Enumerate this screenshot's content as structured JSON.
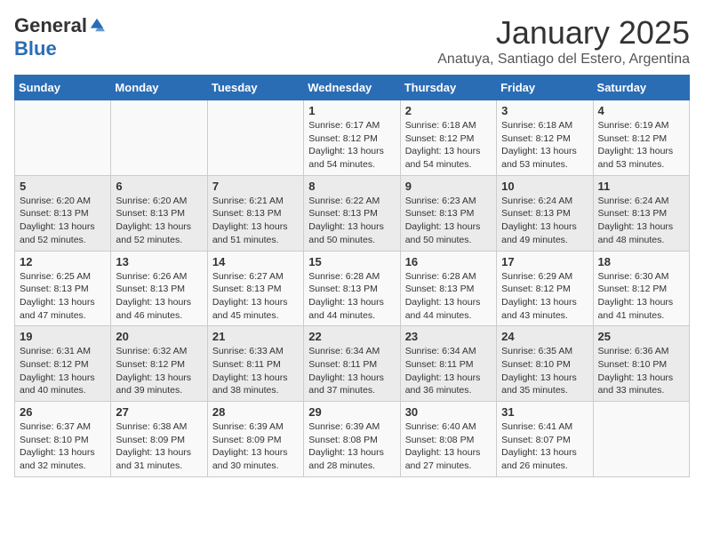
{
  "logo": {
    "general": "General",
    "blue": "Blue"
  },
  "title": "January 2025",
  "subtitle": "Anatuya, Santiago del Estero, Argentina",
  "days_of_week": [
    "Sunday",
    "Monday",
    "Tuesday",
    "Wednesday",
    "Thursday",
    "Friday",
    "Saturday"
  ],
  "weeks": [
    [
      {
        "num": "",
        "sunrise": "",
        "sunset": "",
        "daylight": ""
      },
      {
        "num": "",
        "sunrise": "",
        "sunset": "",
        "daylight": ""
      },
      {
        "num": "",
        "sunrise": "",
        "sunset": "",
        "daylight": ""
      },
      {
        "num": "1",
        "sunrise": "Sunrise: 6:17 AM",
        "sunset": "Sunset: 8:12 PM",
        "daylight": "Daylight: 13 hours and 54 minutes."
      },
      {
        "num": "2",
        "sunrise": "Sunrise: 6:18 AM",
        "sunset": "Sunset: 8:12 PM",
        "daylight": "Daylight: 13 hours and 54 minutes."
      },
      {
        "num": "3",
        "sunrise": "Sunrise: 6:18 AM",
        "sunset": "Sunset: 8:12 PM",
        "daylight": "Daylight: 13 hours and 53 minutes."
      },
      {
        "num": "4",
        "sunrise": "Sunrise: 6:19 AM",
        "sunset": "Sunset: 8:12 PM",
        "daylight": "Daylight: 13 hours and 53 minutes."
      }
    ],
    [
      {
        "num": "5",
        "sunrise": "Sunrise: 6:20 AM",
        "sunset": "Sunset: 8:13 PM",
        "daylight": "Daylight: 13 hours and 52 minutes."
      },
      {
        "num": "6",
        "sunrise": "Sunrise: 6:20 AM",
        "sunset": "Sunset: 8:13 PM",
        "daylight": "Daylight: 13 hours and 52 minutes."
      },
      {
        "num": "7",
        "sunrise": "Sunrise: 6:21 AM",
        "sunset": "Sunset: 8:13 PM",
        "daylight": "Daylight: 13 hours and 51 minutes."
      },
      {
        "num": "8",
        "sunrise": "Sunrise: 6:22 AM",
        "sunset": "Sunset: 8:13 PM",
        "daylight": "Daylight: 13 hours and 50 minutes."
      },
      {
        "num": "9",
        "sunrise": "Sunrise: 6:23 AM",
        "sunset": "Sunset: 8:13 PM",
        "daylight": "Daylight: 13 hours and 50 minutes."
      },
      {
        "num": "10",
        "sunrise": "Sunrise: 6:24 AM",
        "sunset": "Sunset: 8:13 PM",
        "daylight": "Daylight: 13 hours and 49 minutes."
      },
      {
        "num": "11",
        "sunrise": "Sunrise: 6:24 AM",
        "sunset": "Sunset: 8:13 PM",
        "daylight": "Daylight: 13 hours and 48 minutes."
      }
    ],
    [
      {
        "num": "12",
        "sunrise": "Sunrise: 6:25 AM",
        "sunset": "Sunset: 8:13 PM",
        "daylight": "Daylight: 13 hours and 47 minutes."
      },
      {
        "num": "13",
        "sunrise": "Sunrise: 6:26 AM",
        "sunset": "Sunset: 8:13 PM",
        "daylight": "Daylight: 13 hours and 46 minutes."
      },
      {
        "num": "14",
        "sunrise": "Sunrise: 6:27 AM",
        "sunset": "Sunset: 8:13 PM",
        "daylight": "Daylight: 13 hours and 45 minutes."
      },
      {
        "num": "15",
        "sunrise": "Sunrise: 6:28 AM",
        "sunset": "Sunset: 8:13 PM",
        "daylight": "Daylight: 13 hours and 44 minutes."
      },
      {
        "num": "16",
        "sunrise": "Sunrise: 6:28 AM",
        "sunset": "Sunset: 8:13 PM",
        "daylight": "Daylight: 13 hours and 44 minutes."
      },
      {
        "num": "17",
        "sunrise": "Sunrise: 6:29 AM",
        "sunset": "Sunset: 8:12 PM",
        "daylight": "Daylight: 13 hours and 43 minutes."
      },
      {
        "num": "18",
        "sunrise": "Sunrise: 6:30 AM",
        "sunset": "Sunset: 8:12 PM",
        "daylight": "Daylight: 13 hours and 41 minutes."
      }
    ],
    [
      {
        "num": "19",
        "sunrise": "Sunrise: 6:31 AM",
        "sunset": "Sunset: 8:12 PM",
        "daylight": "Daylight: 13 hours and 40 minutes."
      },
      {
        "num": "20",
        "sunrise": "Sunrise: 6:32 AM",
        "sunset": "Sunset: 8:12 PM",
        "daylight": "Daylight: 13 hours and 39 minutes."
      },
      {
        "num": "21",
        "sunrise": "Sunrise: 6:33 AM",
        "sunset": "Sunset: 8:11 PM",
        "daylight": "Daylight: 13 hours and 38 minutes."
      },
      {
        "num": "22",
        "sunrise": "Sunrise: 6:34 AM",
        "sunset": "Sunset: 8:11 PM",
        "daylight": "Daylight: 13 hours and 37 minutes."
      },
      {
        "num": "23",
        "sunrise": "Sunrise: 6:34 AM",
        "sunset": "Sunset: 8:11 PM",
        "daylight": "Daylight: 13 hours and 36 minutes."
      },
      {
        "num": "24",
        "sunrise": "Sunrise: 6:35 AM",
        "sunset": "Sunset: 8:10 PM",
        "daylight": "Daylight: 13 hours and 35 minutes."
      },
      {
        "num": "25",
        "sunrise": "Sunrise: 6:36 AM",
        "sunset": "Sunset: 8:10 PM",
        "daylight": "Daylight: 13 hours and 33 minutes."
      }
    ],
    [
      {
        "num": "26",
        "sunrise": "Sunrise: 6:37 AM",
        "sunset": "Sunset: 8:10 PM",
        "daylight": "Daylight: 13 hours and 32 minutes."
      },
      {
        "num": "27",
        "sunrise": "Sunrise: 6:38 AM",
        "sunset": "Sunset: 8:09 PM",
        "daylight": "Daylight: 13 hours and 31 minutes."
      },
      {
        "num": "28",
        "sunrise": "Sunrise: 6:39 AM",
        "sunset": "Sunset: 8:09 PM",
        "daylight": "Daylight: 13 hours and 30 minutes."
      },
      {
        "num": "29",
        "sunrise": "Sunrise: 6:39 AM",
        "sunset": "Sunset: 8:08 PM",
        "daylight": "Daylight: 13 hours and 28 minutes."
      },
      {
        "num": "30",
        "sunrise": "Sunrise: 6:40 AM",
        "sunset": "Sunset: 8:08 PM",
        "daylight": "Daylight: 13 hours and 27 minutes."
      },
      {
        "num": "31",
        "sunrise": "Sunrise: 6:41 AM",
        "sunset": "Sunset: 8:07 PM",
        "daylight": "Daylight: 13 hours and 26 minutes."
      },
      {
        "num": "",
        "sunrise": "",
        "sunset": "",
        "daylight": ""
      }
    ]
  ]
}
